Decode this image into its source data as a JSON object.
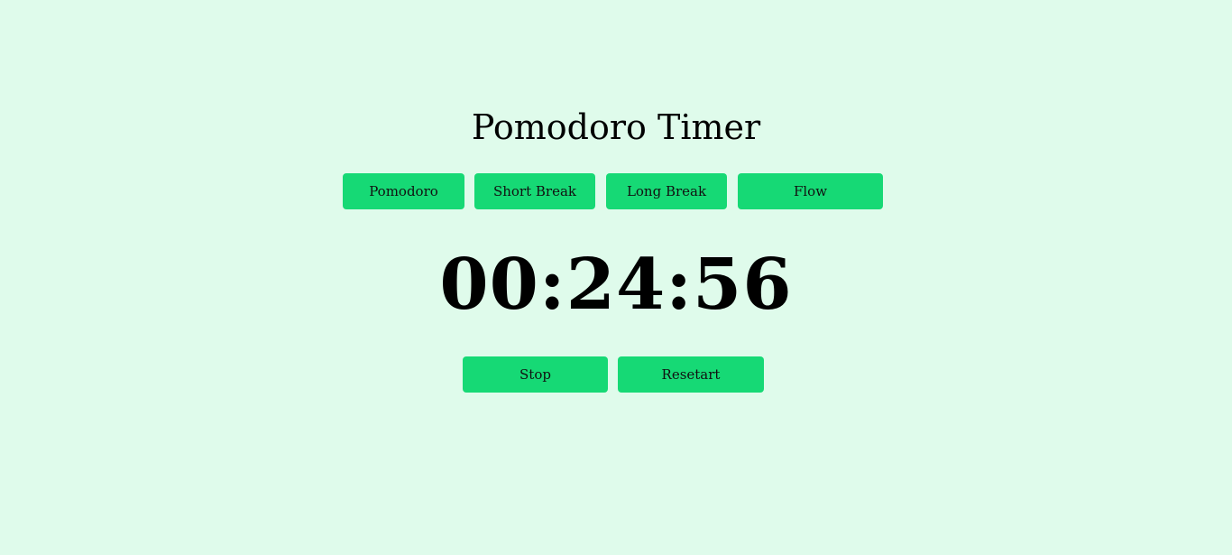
{
  "app": {
    "title": "Pomodoro Timer"
  },
  "modes": [
    {
      "label": "Pomodoro"
    },
    {
      "label": "Short Break"
    },
    {
      "label": "Long Break"
    },
    {
      "label": "Flow"
    }
  ],
  "timer": {
    "display": "00:24:56"
  },
  "controls": {
    "stop_label": "Stop",
    "restart_label": "Resetart"
  },
  "colors": {
    "background": "#dffbeb",
    "button": "#16d975",
    "text": "#000000"
  }
}
